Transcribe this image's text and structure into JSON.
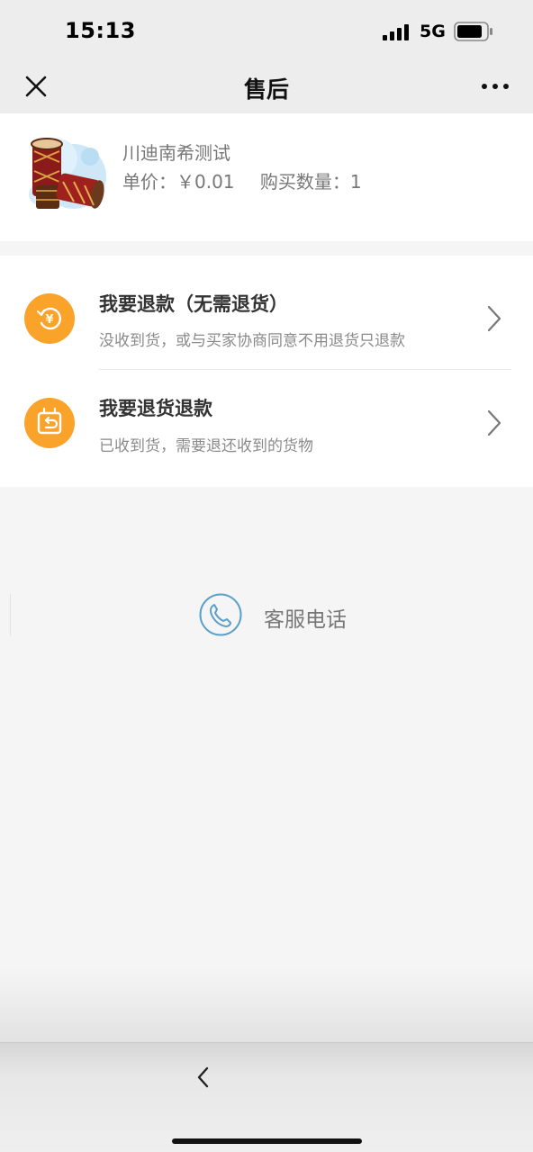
{
  "status_bar": {
    "time": "15:13",
    "network": "5G"
  },
  "nav": {
    "title": "售后"
  },
  "product": {
    "name": "川迪南希测试",
    "price_label": "单价：",
    "price": "￥0.01",
    "qty_label": "购买数量：",
    "qty": "1"
  },
  "options": [
    {
      "title": "我要退款（无需退货）",
      "desc": "没收到货，或与买家协商同意不用退货只退款",
      "icon": "refund-icon"
    },
    {
      "title": "我要退货退款",
      "desc": "已收到货，需要退还收到的货物",
      "icon": "return-box-icon"
    }
  ],
  "service": {
    "label": "客服电话",
    "icon": "phone-icon"
  },
  "colors": {
    "accent": "#f9a32a",
    "phone_icon": "#5aa0c8"
  }
}
